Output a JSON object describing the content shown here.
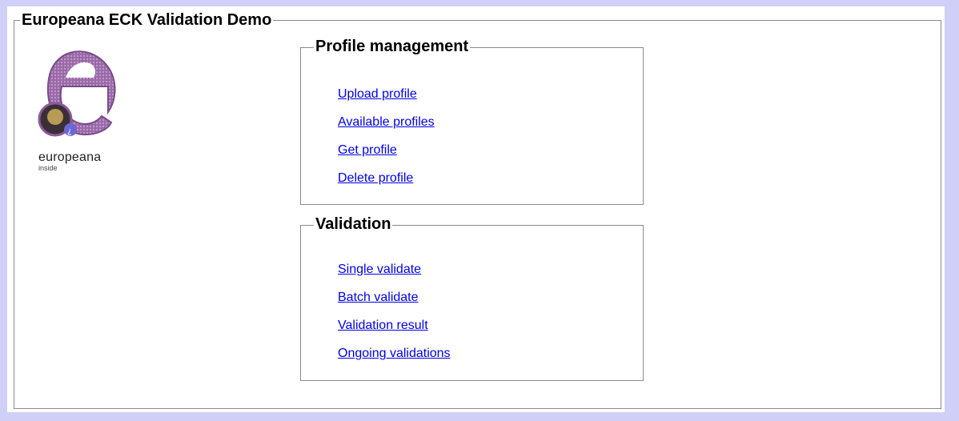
{
  "page": {
    "title": "Europeana ECK Validation Demo"
  },
  "logo": {
    "name": "europeana",
    "sub": "inside"
  },
  "profile_management": {
    "title": "Profile management",
    "links": [
      "Upload profile",
      "Available profiles",
      "Get profile",
      "Delete profile"
    ]
  },
  "validation": {
    "title": "Validation",
    "links": [
      "Single validate",
      "Batch validate",
      "Validation result",
      "Ongoing validations"
    ]
  },
  "colors": {
    "background": "#cfcff7",
    "panel": "#ffffff",
    "link": "#0000ee",
    "border": "#8a8a8a"
  }
}
